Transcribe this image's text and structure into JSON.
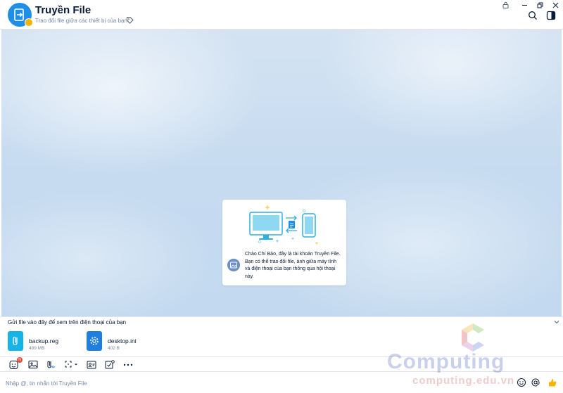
{
  "header": {
    "title": "Truyền File",
    "subtitle": "Trao đổi file giữa các thiết bị của bạn",
    "icons": [
      "lock-icon",
      "minimize-icon",
      "restore-icon",
      "close-icon",
      "search-icon",
      "sidebar-toggle-icon",
      "tag-icon"
    ]
  },
  "welcome": {
    "message": "Chào Chí Bảo, đây là tài khoản Truyền File. Bạn có thể trao đổi file, ảnh giữa máy tính và điện thoại của bạn thông qua hội thoại này."
  },
  "drop_zone": {
    "label": "Gửi file vào đây để xem trên điện thoại của bạn",
    "files": [
      {
        "name": "backup.reg",
        "size": "489 MB",
        "icon": "attachment-file-icon",
        "color": "#14b4e8"
      },
      {
        "name": "desktop.ini",
        "size": "402 B",
        "icon": "settings-file-icon",
        "color": "#1e7fe0"
      }
    ]
  },
  "toolbar": {
    "sticker_badge": "N",
    "hd_label": "HD",
    "icons": [
      "sticker-icon",
      "image-icon",
      "attach-hd-icon",
      "screenshot-icon",
      "contact-card-icon",
      "task-icon",
      "more-icon"
    ]
  },
  "input": {
    "placeholder": "Nhập @, tin nhắn tới Truyền File"
  },
  "watermark": {
    "title": "Computing",
    "url": "computing.edu.vn"
  },
  "colors": {
    "accent": "#0068ff",
    "avatar": "#1e8ee6",
    "badge": "#f5b400"
  }
}
